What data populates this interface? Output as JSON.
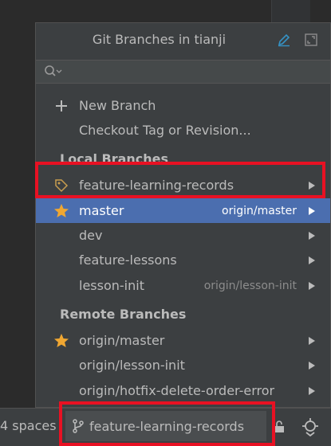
{
  "popup": {
    "title": "Git Branches in tianji",
    "search": {
      "value": "",
      "placeholder": ""
    }
  },
  "actions": [
    {
      "label": "New Branch",
      "icon": "plus-icon"
    },
    {
      "label": "Checkout Tag or Revision..."
    }
  ],
  "local_section_label": "Local Branches",
  "local_branches": [
    {
      "name": "feature-learning-records",
      "icon": "tag-icon",
      "tracking": ""
    },
    {
      "name": "master",
      "icon": "star-icon",
      "tracking": "origin/master",
      "selected": true
    },
    {
      "name": "dev",
      "tracking": ""
    },
    {
      "name": "feature-lessons",
      "tracking": ""
    },
    {
      "name": "lesson-init",
      "tracking": "origin/lesson-init"
    }
  ],
  "remote_section_label": "Remote Branches",
  "remote_branches": [
    {
      "name": "origin/master",
      "icon": "star-icon"
    },
    {
      "name": "origin/lesson-init"
    },
    {
      "name": "origin/hotfix-delete-order-error"
    }
  ],
  "statusbar": {
    "indent": "4 spaces",
    "branch": "feature-learning-records"
  },
  "colors": {
    "selection": "#4b6eaf",
    "highlight_box": "#e81123",
    "star": "#f0a732",
    "tag": "#c89d4f"
  }
}
